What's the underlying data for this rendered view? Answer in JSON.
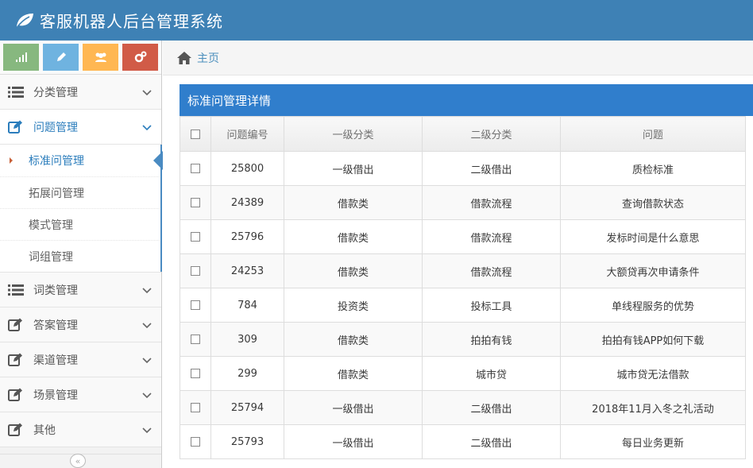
{
  "app": {
    "title": "客服机器人后台管理系统"
  },
  "shortcuts": [
    {
      "icon": "signal-icon",
      "color": "#87b87f"
    },
    {
      "icon": "pencil-icon",
      "color": "#6fb3e0"
    },
    {
      "icon": "users-icon",
      "color": "#ffb752"
    },
    {
      "icon": "cogs-icon",
      "color": "#d15b47"
    }
  ],
  "sidebar": {
    "items": [
      {
        "label": "分类管理",
        "icon": "list-icon"
      },
      {
        "label": "问题管理",
        "icon": "edit-icon",
        "active": true,
        "children": [
          {
            "label": "标准问管理",
            "current": true
          },
          {
            "label": "拓展问管理"
          },
          {
            "label": "模式管理"
          },
          {
            "label": "词组管理"
          }
        ]
      },
      {
        "label": "词类管理",
        "icon": "list-icon"
      },
      {
        "label": "答案管理",
        "icon": "edit-icon"
      },
      {
        "label": "渠道管理",
        "icon": "edit-icon"
      },
      {
        "label": "场景管理",
        "icon": "edit-icon"
      },
      {
        "label": "其他",
        "icon": "edit-icon"
      }
    ],
    "collapse_glyph": "«"
  },
  "breadcrumb": {
    "home": "主页"
  },
  "panel": {
    "title": "标准问管理详情"
  },
  "table": {
    "columns": [
      "问题编号",
      "一级分类",
      "二级分类",
      "问题"
    ],
    "rows": [
      [
        "25800",
        "一级借出",
        "二级借出",
        "质检标准"
      ],
      [
        "24389",
        "借款类",
        "借款流程",
        "查询借款状态"
      ],
      [
        "25796",
        "借款类",
        "借款流程",
        "发标时间是什么意思"
      ],
      [
        "24253",
        "借款类",
        "借款流程",
        "大额贷再次申请条件"
      ],
      [
        "784",
        "投资类",
        "投标工具",
        "单线程服务的优势"
      ],
      [
        "309",
        "借款类",
        "拍拍有钱",
        "拍拍有钱APP如何下载"
      ],
      [
        "299",
        "借款类",
        "城市贷",
        "城市贷无法借款"
      ],
      [
        "25794",
        "一级借出",
        "二级借出",
        "2018年11月入冬之礼活动"
      ],
      [
        "25793",
        "一级借出",
        "二级借出",
        "每日业务更新"
      ]
    ]
  },
  "colors": {
    "navbar": "#3e81b5",
    "panel_header": "#307ecc",
    "link": "#2b7dbc"
  }
}
